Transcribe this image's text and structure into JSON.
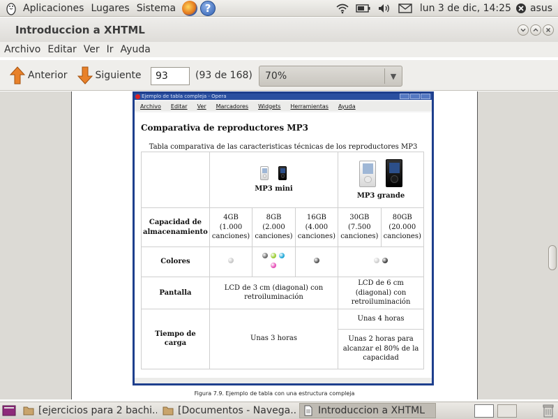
{
  "top_panel": {
    "menus": [
      "Aplicaciones",
      "Lugares",
      "Sistema"
    ],
    "clock": "lun  3 de dic, 14:25",
    "user": "asus"
  },
  "window": {
    "title": "Introduccion a XHTML"
  },
  "menubar": [
    "Archivo",
    "Editar",
    "Ver",
    "Ir",
    "Ayuda"
  ],
  "toolbar": {
    "prev_label": "Anterior",
    "next_label": "Siguiente",
    "page_value": "93",
    "page_count": "(93 de 168)",
    "zoom_value": "70%"
  },
  "opera": {
    "title": "Ejemplo de tabla compleja - Opera",
    "menus": [
      "Archivo",
      "Editar",
      "Ver",
      "Marcadores",
      "Widgets",
      "Herramientas",
      "Ayuda"
    ],
    "heading": "Comparativa de reproductores MP3",
    "caption": "Tabla comparativa de las caracteristicas técnicas de los reproductores MP3",
    "table": {
      "mini_label": "MP3 mini",
      "grande_label": "MP3 grande",
      "capacity_label": "Capacidad de almacenamiento",
      "capacities": [
        {
          "size": "4GB",
          "songs": "(1.000 canciones)"
        },
        {
          "size": "8GB",
          "songs": "(2.000 canciones)"
        },
        {
          "size": "16GB",
          "songs": "(4.000 canciones)"
        },
        {
          "size": "30GB",
          "songs": "(7.500 canciones)"
        },
        {
          "size": "80GB",
          "songs": "(20.000 canciones)"
        }
      ],
      "colors_label": "Colores",
      "colors": {
        "mini_4gb": [
          "#c8c8c8"
        ],
        "mini_8gb": [
          "#6a6a6a",
          "#9acd32",
          "#20a8d8",
          "#e64fb8"
        ],
        "mini_16gb": [
          "#555555"
        ],
        "grande": [
          "#cfcfcf",
          "#444444"
        ]
      },
      "screen_label": "Pantalla",
      "screen_mini": "LCD de 3 cm (diagonal) con retroiluminación",
      "screen_grande": "LCD de 6 cm (diagonal) con retroiluminación",
      "charge_label": "Tiempo de carga",
      "charge_mini": "Unas 3 horas",
      "charge_grande_1": "Unas 4 horas",
      "charge_grande_2": "Unas 2 horas para alcanzar el 80% de la capacidad"
    }
  },
  "figure_caption": "Figura 7.9. Ejemplo de tabla con una estructura compleja",
  "taskbar": {
    "tasks": [
      {
        "label": "[ejercicios para 2 bachi...",
        "icon": "folder-icon"
      },
      {
        "label": "[Documentos - Navega...",
        "icon": "folder-icon"
      },
      {
        "label": "Introduccion a XHTML",
        "icon": "document-icon",
        "active": true
      }
    ]
  }
}
